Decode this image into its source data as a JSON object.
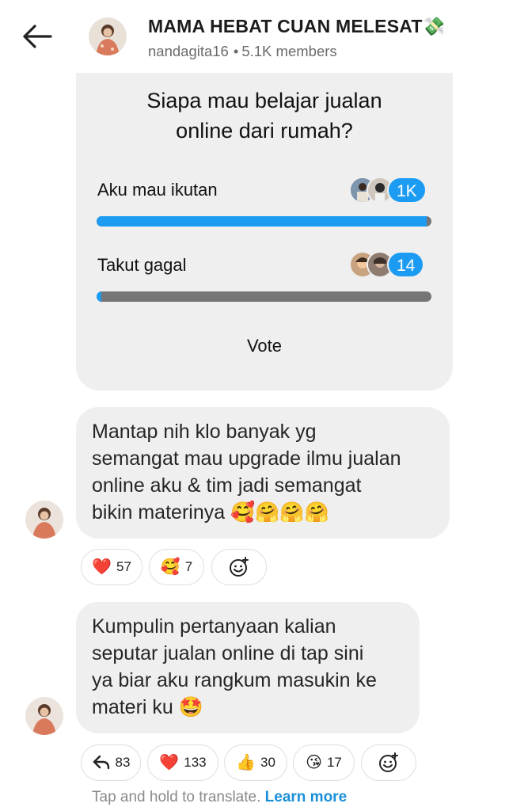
{
  "header": {
    "group_name": "MAMA HEBAT CUAN MELESAT💸",
    "admin": "nandagita16",
    "dot": "•",
    "members": "5.1K members"
  },
  "poll": {
    "question_line1": "Siapa mau belajar jualan",
    "question_line2": "online dari rumah?",
    "options": [
      {
        "label": "Aku mau ikutan",
        "count": "1K",
        "fraction": 0.986
      },
      {
        "label": "Takut gagal",
        "count": "14",
        "fraction": 0.014
      }
    ],
    "vote_label": "Vote"
  },
  "messages": [
    {
      "text": "Mantap nih klo banyak yg semangat mau upgrade ilmu jualan online aku & tim jadi semangat bikin materinya 🥰🤗🤗🤗",
      "lines": [
        "Mantap nih klo banyak yg",
        "semangat mau upgrade ilmu jualan",
        "online aku & tim jadi semangat",
        "bikin materinya 🥰🤗🤗🤗"
      ],
      "reactions": [
        {
          "emoji": "❤️",
          "count": "57"
        },
        {
          "emoji": "🥰",
          "count": "7"
        }
      ]
    },
    {
      "lines": [
        "Kumpulin pertanyaan kalian",
        "seputar jualan online di tap sini",
        "ya biar aku rangkum masukin ke",
        "materi ku 🤩"
      ],
      "reactions": [
        {
          "emoji": "reply-arrow",
          "count": "83"
        },
        {
          "emoji": "❤️",
          "count": "133"
        },
        {
          "emoji": "👍",
          "count": "30"
        },
        {
          "emoji": "😘",
          "count": "17"
        }
      ]
    }
  ],
  "footer": {
    "hint": "Tap and hold to translate.",
    "link": "Learn more"
  },
  "colors": {
    "accent": "#1b9cf2",
    "bubble": "#efefef",
    "bar_track": "#767676"
  }
}
